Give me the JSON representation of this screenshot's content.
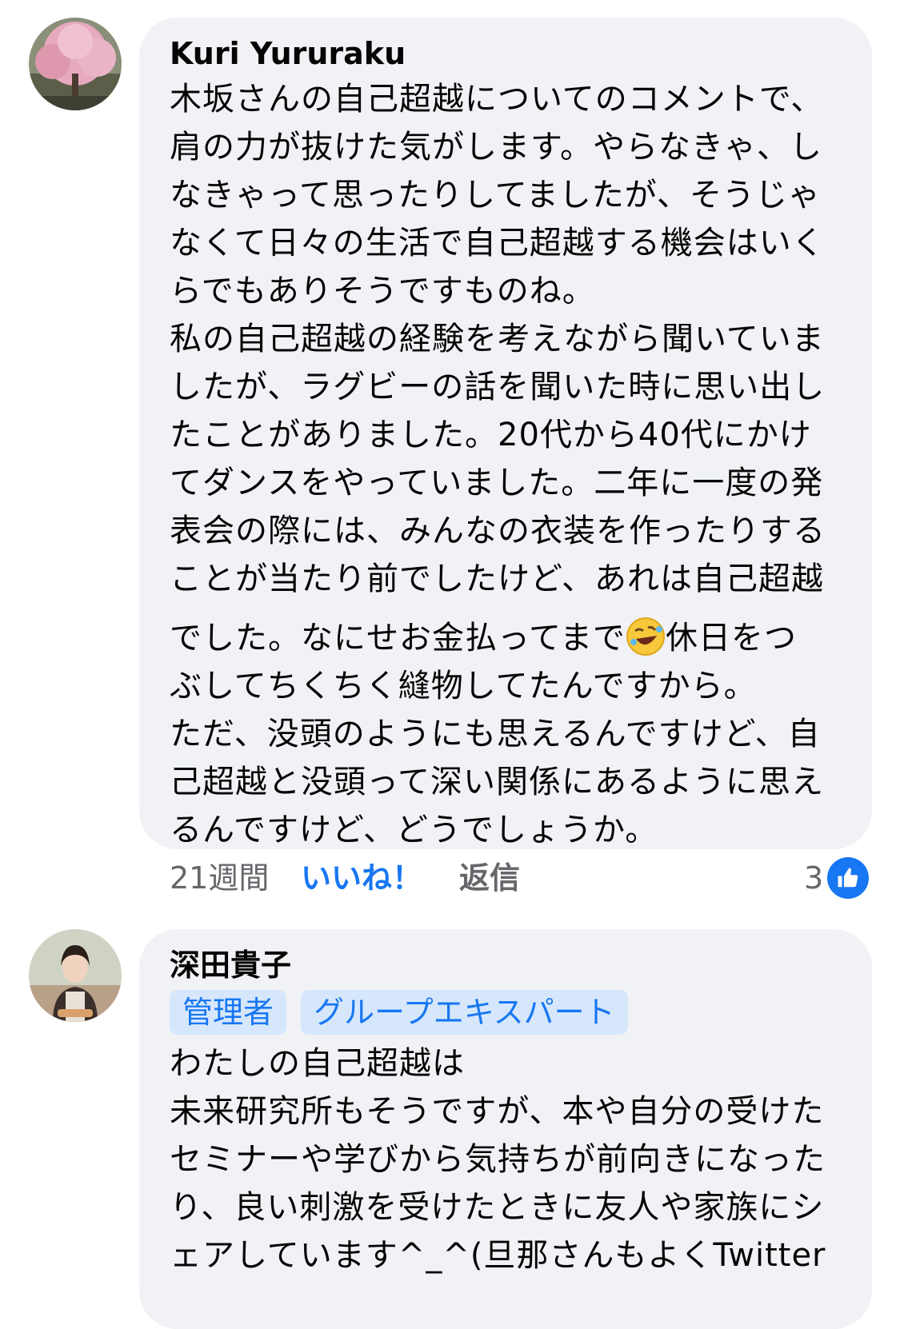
{
  "comments": [
    {
      "author": "Kuri Yururaku",
      "avatar_icon": "cherry-blossom-photo",
      "body_lines": [
        "木坂さんの自己超越についてのコメントで、",
        "肩の力が抜けた気がします。やらなきゃ、し",
        "なきゃって思ったりしてましたが、そうじゃ",
        "なくて日々の生活で自己超越する機会はいく",
        "らでもありそうですものね。",
        "私の自己超越の経験を考えながら聞いていま",
        "したが、ラグビーの話を聞いた時に思い出し",
        "たことがありました。20代から40代にかけ",
        "てダンスをやっていました。二年に一度の発",
        "表会の際には、みんなの衣装を作ったりする",
        "ことが当たり前でしたけど、あれは自己超越"
      ],
      "emoji_line_before": "でした。なにせお金払ってまで",
      "emoji_icon": "rofl-emoji",
      "emoji_line_after": "休日をつ",
      "body_lines_2": [
        "ぶしてちくちく縫物してたんですから。",
        "ただ、没頭のようにも思えるんですけど、自",
        "己超越と没頭って深い関係にあるように思え",
        "るんですけど、どうでしょうか。"
      ],
      "time": "21週間",
      "like_label": "いいね！",
      "reply_label": "返信",
      "reaction_count": "3",
      "reaction_icon": "thumbs-up-icon",
      "accent_color": "#1877f2"
    },
    {
      "author": "深田貴子",
      "avatar_icon": "woman-portrait-photo",
      "badges": [
        "管理者",
        "グループエキスパート"
      ],
      "body_lines": [
        "わたしの自己超越は",
        "未来研究所もそうですが、本や自分の受けた",
        "セミナーや学びから気持ちが前向きになった",
        "り、良い刺激を受けたときに友人や家族にシ",
        "ェアしています^_^(旦那さんもよくTwitter"
      ]
    }
  ]
}
